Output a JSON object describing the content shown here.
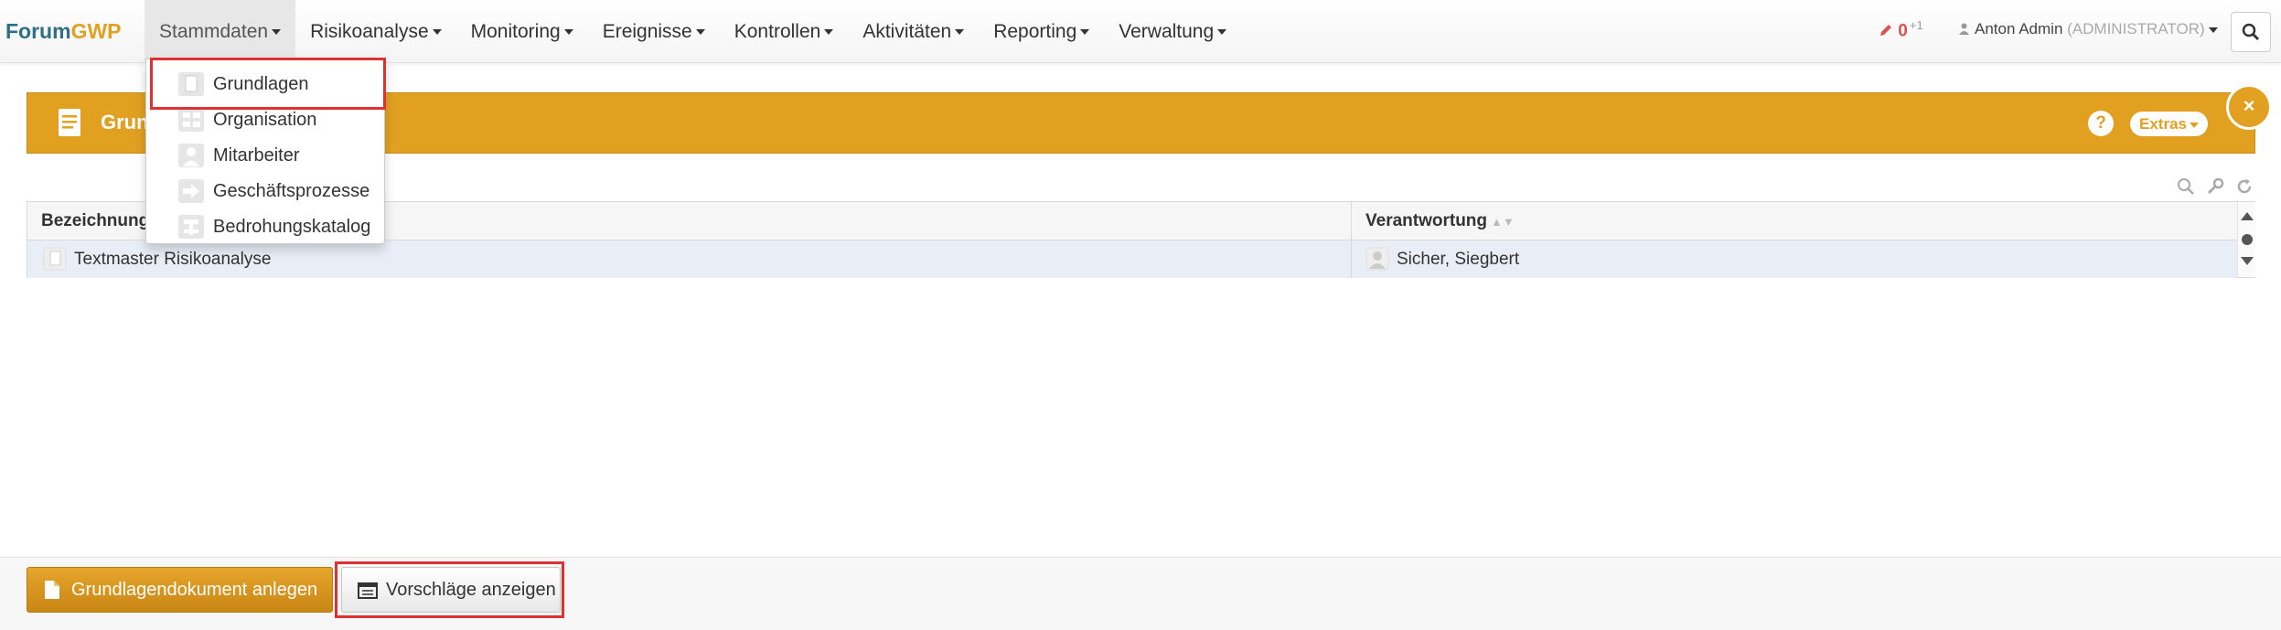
{
  "brand": {
    "part1": "Forum",
    "part2": "GWP"
  },
  "nav": {
    "items": [
      {
        "label": "Stammdaten"
      },
      {
        "label": "Risikoanalyse"
      },
      {
        "label": "Monitoring"
      },
      {
        "label": "Ereignisse"
      },
      {
        "label": "Kontrollen"
      },
      {
        "label": "Aktivitäten"
      },
      {
        "label": "Reporting"
      },
      {
        "label": "Verwaltung"
      }
    ],
    "notifications": {
      "count": "0",
      "delta": "+1"
    },
    "user": {
      "name": "Anton Admin",
      "role": "(ADMINISTRATOR)"
    }
  },
  "dropdown": {
    "items": [
      {
        "label": "Grundlagen",
        "icon": "document-icon"
      },
      {
        "label": "Organisation",
        "icon": "org-chart-icon"
      },
      {
        "label": "Mitarbeiter",
        "icon": "person-icon"
      },
      {
        "label": "Geschäftsprozesse",
        "icon": "arrow-right-icon"
      },
      {
        "label": "Bedrohungskatalog",
        "icon": "catalog-icon"
      }
    ]
  },
  "panel": {
    "title": "Grun",
    "help": "?",
    "extras": "Extras"
  },
  "table": {
    "columns": [
      "Bezeichnung",
      "Verantwortung"
    ],
    "rows": [
      {
        "bezeichnung": "Textmaster Risikoanalyse",
        "verantwortung": "Sicher, Siegbert"
      }
    ]
  },
  "footer": {
    "primary_button": "Grundlagendokument anlegen",
    "secondary_button": "Vorschläge anzeigen"
  },
  "colors": {
    "brand_blue": "#2f6f86",
    "accent_orange": "#e1a020",
    "highlight_red": "#e03030"
  }
}
